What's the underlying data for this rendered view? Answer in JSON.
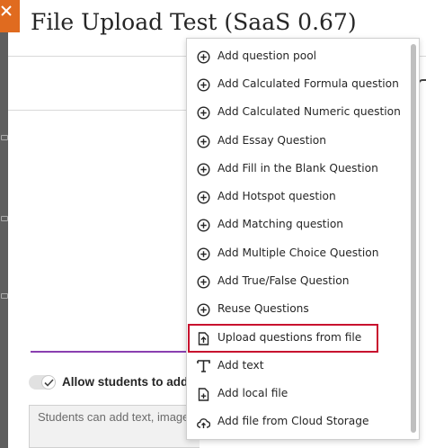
{
  "page": {
    "title": "File Upload Test (SaaS 0.67)"
  },
  "side": {
    "close_icon": "close-x-icon"
  },
  "settings": {
    "allow_label": "Allow students to add co",
    "students_placeholder": "Students can add text, images"
  },
  "menu": {
    "items": [
      {
        "label": "Add question pool",
        "icon": "plus-circle-icon"
      },
      {
        "label": "Add Calculated Formula question",
        "icon": "plus-circle-icon"
      },
      {
        "label": "Add Calculated Numeric question",
        "icon": "plus-circle-icon"
      },
      {
        "label": "Add Essay Question",
        "icon": "plus-circle-icon"
      },
      {
        "label": "Add Fill in the Blank Question",
        "icon": "plus-circle-icon"
      },
      {
        "label": "Add Hotspot question",
        "icon": "plus-circle-icon"
      },
      {
        "label": "Add Matching question",
        "icon": "plus-circle-icon"
      },
      {
        "label": "Add Multiple Choice Question",
        "icon": "plus-circle-icon"
      },
      {
        "label": "Add True/False Question",
        "icon": "plus-circle-icon"
      },
      {
        "label": "Reuse Questions",
        "icon": "plus-circle-icon"
      },
      {
        "label": "Upload questions from file",
        "icon": "file-upload-icon"
      },
      {
        "label": "Add text",
        "icon": "text-format-icon"
      },
      {
        "label": "Add local file",
        "icon": "file-add-icon"
      },
      {
        "label": "Add file from Cloud Storage",
        "icon": "cloud-upload-icon"
      }
    ],
    "highlighted_item": "Upload questions from file"
  },
  "colors": {
    "accent_orange": "#e06b1f",
    "highlight_red": "#c8102e",
    "divider_purple": "#8a3fb0"
  }
}
